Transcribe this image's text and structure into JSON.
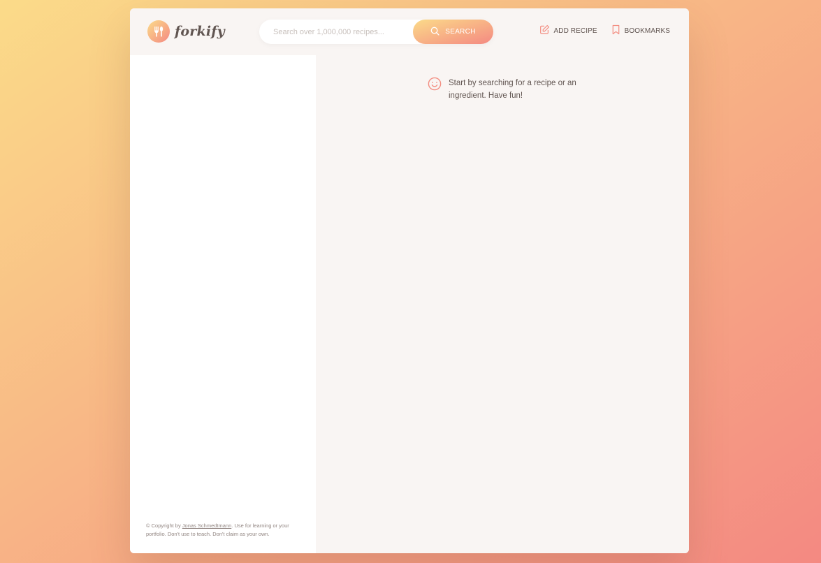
{
  "brand": {
    "name": "forkify",
    "icon": "fork-spoon-icon",
    "gradient": [
      "#fbdb89",
      "#f48982"
    ]
  },
  "search": {
    "placeholder": "Search over 1,000,000 recipes...",
    "value": "",
    "button_label": "SEARCH",
    "button_icon": "search-icon"
  },
  "nav": {
    "add_recipe": {
      "label": "ADD RECIPE",
      "icon": "edit-icon"
    },
    "bookmarks": {
      "label": "BOOKMARKS",
      "icon": "bookmark-icon"
    }
  },
  "recipe_panel": {
    "message": "Start by searching for a recipe or an ingredient. Have fun!",
    "message_icon": "smile-icon"
  },
  "footer": {
    "copyright_prefix": "© Copyright by ",
    "author": "Jonas Schmedtmann",
    "copyright_suffix": ". Use for learning or your portfolio. Don't use to teach. Don't claim as your own."
  },
  "colors": {
    "accent": "#f38e82",
    "text": "#615551",
    "panel_bg": "#f9f5f3",
    "muted": "#918581"
  }
}
